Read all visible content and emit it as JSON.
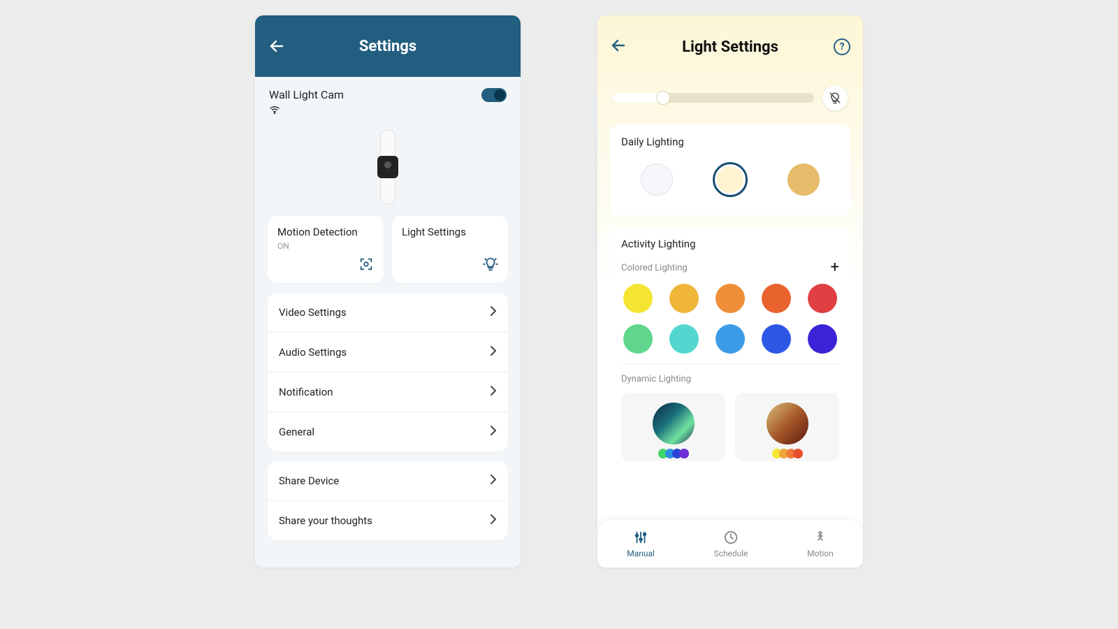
{
  "phone1": {
    "header": {
      "title": "Settings"
    },
    "device": {
      "name": "Wall Light Cam",
      "powerOn": true
    },
    "quickCards": {
      "motion": {
        "title": "Motion Detection",
        "status": "ON"
      },
      "light": {
        "title": "Light Settings"
      }
    },
    "listA": [
      {
        "label": "Video Settings"
      },
      {
        "label": "Audio Settings"
      },
      {
        "label": "Notification"
      },
      {
        "label": "General"
      }
    ],
    "listB": [
      {
        "label": "Share Device"
      },
      {
        "label": "Share your thoughts"
      }
    ]
  },
  "phone2": {
    "header": {
      "title": "Light Settings"
    },
    "brightness": {
      "percent": 25
    },
    "daily": {
      "title": "Daily Lighting",
      "swatches": [
        {
          "color": "#f5f7fd",
          "selected": false
        },
        {
          "color": "#fff4cf",
          "selected": true
        },
        {
          "color": "#e6bb6a",
          "selected": false
        }
      ]
    },
    "activity": {
      "title": "Activity Lighting",
      "coloredTitle": "Colored Lighting",
      "colors": [
        "#f5e533",
        "#f0b63a",
        "#ef8f3a",
        "#e8632e",
        "#e14042",
        "#5fd68b",
        "#53d6cf",
        "#3d9ce8",
        "#2f57e6",
        "#3a24d6"
      ],
      "dynamicTitle": "Dynamic Lighting",
      "dynamic": [
        {
          "gradient": "linear-gradient(135deg,#0b2a4a 0%,#1b6e7a 40%,#6fe3a0 70%,#1b2a5a 100%)",
          "dots": [
            "#3fd66a",
            "#2f8fe0",
            "#2b46d6",
            "#6f2fd6"
          ]
        },
        {
          "gradient": "linear-gradient(135deg,#d8c07a 0%,#a85a2a 50%,#5a180e 100%)",
          "dots": [
            "#f5e533",
            "#f0a63a",
            "#ef7a3a",
            "#e8502e"
          ]
        }
      ]
    },
    "tabs": [
      {
        "label": "Manual",
        "active": true
      },
      {
        "label": "Schedule",
        "active": false
      },
      {
        "label": "Motion",
        "active": false
      }
    ]
  }
}
